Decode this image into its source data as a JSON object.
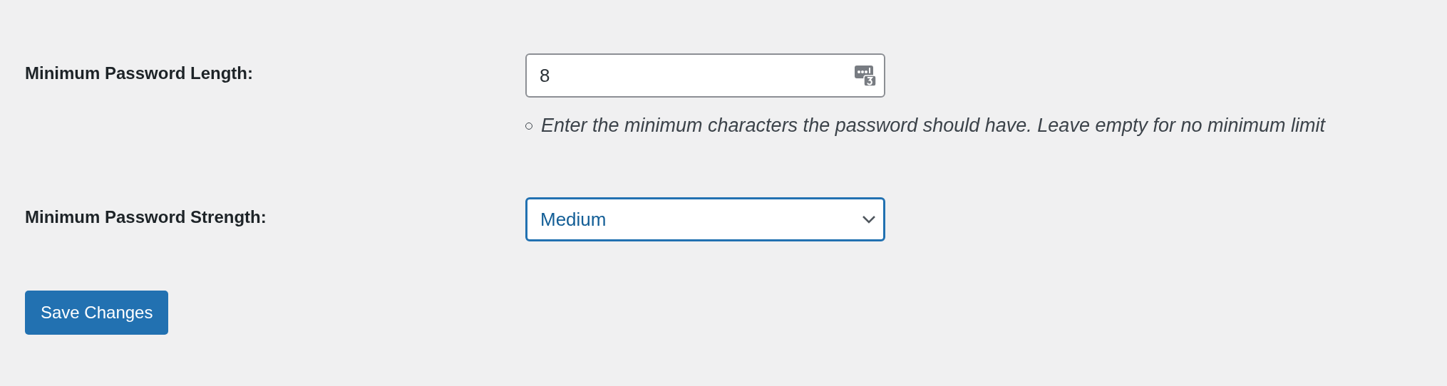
{
  "fields": [
    {
      "kind": "number",
      "label": "Minimum Password Length:",
      "value": "8",
      "hints": [
        "Enter the minimum characters the password should have. Leave empty for no minimum limit"
      ],
      "focused": false
    },
    {
      "kind": "select",
      "label": "Minimum Password Strength:",
      "value": "Medium",
      "focused": true
    }
  ],
  "save_button": "Save Changes"
}
